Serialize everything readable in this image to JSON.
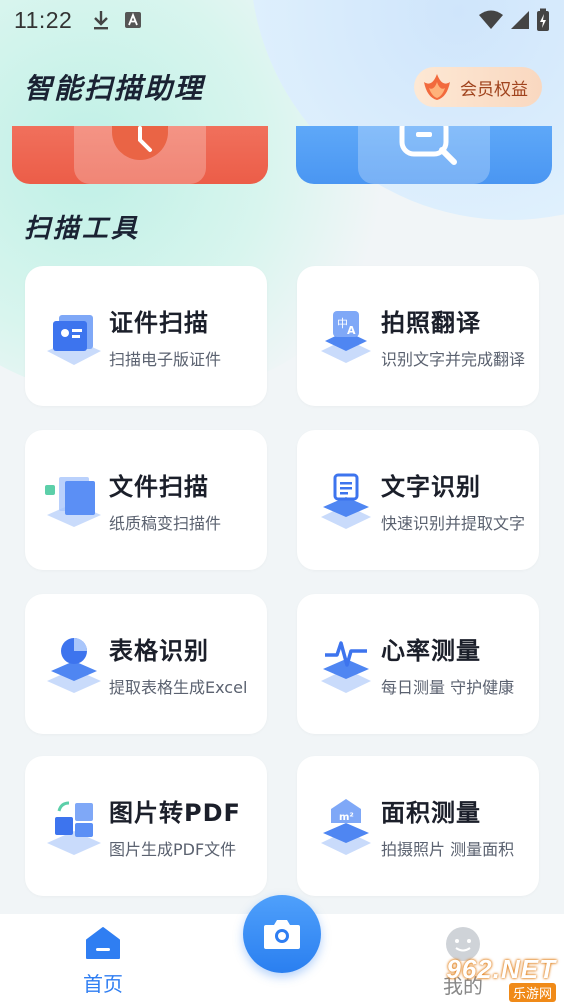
{
  "status_bar": {
    "time": "11:22"
  },
  "header": {
    "title": "智能扫描助理",
    "vip_label": "会员权益"
  },
  "section": {
    "title": "扫描工具"
  },
  "tools": [
    {
      "name": "证件扫描",
      "desc": "扫描电子版证件",
      "icon": "id-card-scan-icon"
    },
    {
      "name": "拍照翻译",
      "desc": "识别文字并完成翻译",
      "icon": "translate-icon"
    },
    {
      "name": "文件扫描",
      "desc": "纸质稿变扫描件",
      "icon": "document-scan-icon"
    },
    {
      "name": "文字识别",
      "desc": "快速识别并提取文字",
      "icon": "text-recognition-icon"
    },
    {
      "name": "表格识别",
      "desc": "提取表格生成Excel",
      "icon": "table-recognition-icon"
    },
    {
      "name": "心率测量",
      "desc": "每日测量 守护健康",
      "icon": "heart-rate-icon"
    },
    {
      "name": "图片转PDF",
      "desc": "图片生成PDF文件",
      "icon": "image-to-pdf-icon"
    },
    {
      "name": "面积测量",
      "desc": "拍摄照片 测量面积",
      "icon": "area-measure-icon"
    }
  ],
  "bottom_nav": {
    "home_label": "首页",
    "me_label": "我的"
  },
  "watermark": {
    "logo": "962.NET",
    "sub": "乐游网"
  },
  "colors": {
    "accent": "#2f7ef2",
    "vip": "#a0431d",
    "banner_red": "#ec5d48",
    "banner_blue": "#4a96f2"
  }
}
